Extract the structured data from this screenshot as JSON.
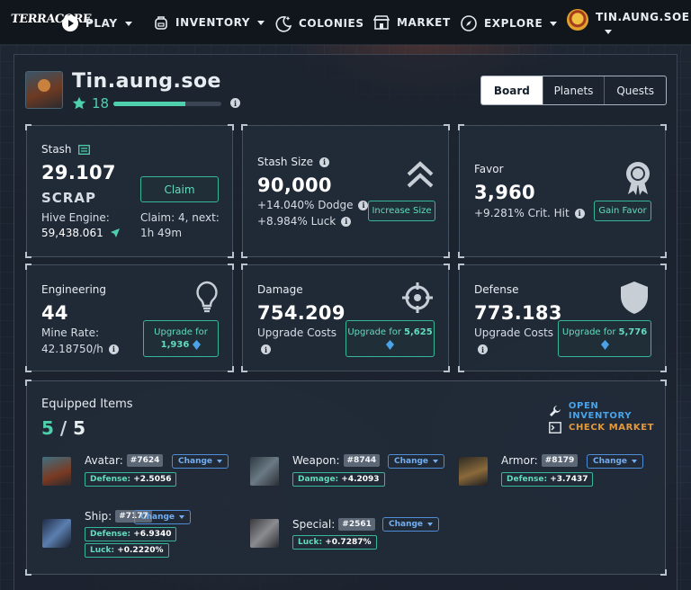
{
  "nav": {
    "logo": "TERRACORE",
    "items": [
      {
        "label": "PLAY",
        "icon": "play-icon",
        "caret": true
      },
      {
        "label": "INVENTORY",
        "icon": "backpack-icon",
        "caret": true
      },
      {
        "label": "COLONIES",
        "icon": "moon-stars-icon",
        "caret": false
      },
      {
        "label": "MARKET",
        "icon": "store-icon",
        "caret": false
      },
      {
        "label": "EXPLORE",
        "icon": "compass-icon",
        "caret": true
      }
    ],
    "user": "TIN.AUNG.SOE"
  },
  "profile": {
    "name": "Tin.aung.soe",
    "level": "18",
    "xp_fraction": 0.67
  },
  "tabs": [
    "Board",
    "Planets",
    "Quests"
  ],
  "stash": {
    "label": "Stash",
    "value": "29.107",
    "unit": "SCRAP",
    "hive_label": "Hive Engine:",
    "hive_value": "59,438.061",
    "claim_button": "Claim",
    "claim_info": "Claim: 4, next:",
    "claim_next": "1h 49m"
  },
  "stash_size": {
    "label": "Stash Size",
    "value": "90,000",
    "line1": "+14.040% Dodge",
    "line2": "+8.984% Luck",
    "button": "Increase Size"
  },
  "favor": {
    "label": "Favor",
    "value": "3,960",
    "line1": "+9.281% Crit. Hit",
    "button": "Gain Favor"
  },
  "engineering": {
    "label": "Engineering",
    "value": "44",
    "line1": "Mine Rate:",
    "line2": "42.18750/h",
    "button_label": "Upgrade for",
    "button_amount": "1,936"
  },
  "damage": {
    "label": "Damage",
    "value": "754.209",
    "line1": "Upgrade Costs",
    "button_label": "Upgrade for",
    "button_amount": "5,625"
  },
  "defense": {
    "label": "Defense",
    "value": "773.183",
    "line1": "Upgrade Costs",
    "button_label": "Upgrade for",
    "button_amount": "5,776"
  },
  "equipped": {
    "title": "Equipped Items",
    "count": "5",
    "total": "5",
    "open_inventory": "OPEN INVENTORY",
    "check_market": "CHECK MARKET",
    "change_label": "Change",
    "items": [
      {
        "slot": "Avatar:",
        "id": "#7624",
        "stats": [
          {
            "k": "Defense:",
            "v": "+2.5056"
          }
        ]
      },
      {
        "slot": "Weapon:",
        "id": "#8744",
        "stats": [
          {
            "k": "Damage:",
            "v": "+4.2093"
          }
        ]
      },
      {
        "slot": "Armor:",
        "id": "#8179",
        "stats": [
          {
            "k": "Defense:",
            "v": "+3.7437"
          }
        ]
      },
      {
        "slot": "Ship:",
        "id": "#7177",
        "stats": [
          {
            "k": "Defense:",
            "v": "+6.9340"
          },
          {
            "k": "Luck:",
            "v": "+0.2220%"
          }
        ]
      },
      {
        "slot": "Special:",
        "id": "#2561",
        "stats": [
          {
            "k": "Luck:",
            "v": "+0.7287%"
          }
        ]
      }
    ]
  },
  "colors": {
    "accent_teal": "#4fd0ad",
    "link_blue": "#4aa3e8",
    "market_orange": "#e39a3b"
  }
}
